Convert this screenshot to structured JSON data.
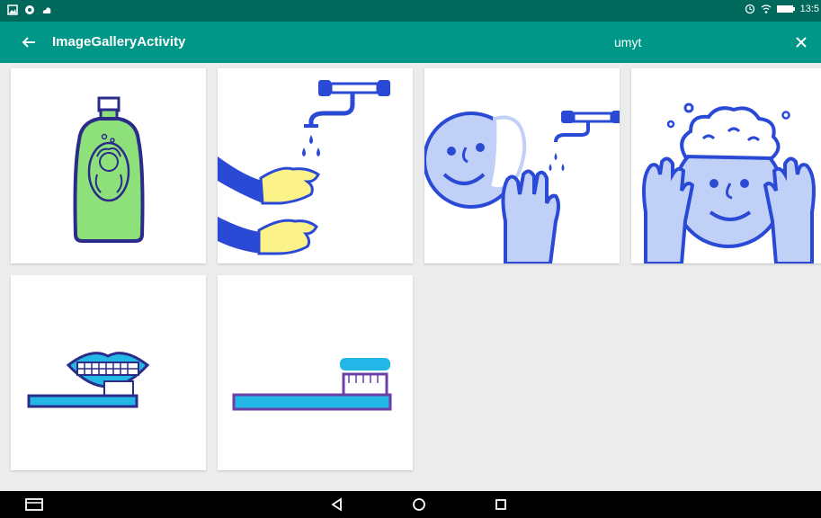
{
  "status_bar": {
    "time": "13:5",
    "left_icons": [
      "gallery-icon",
      "notification-icon",
      "cloud-icon"
    ],
    "right_icons": [
      "alarm-icon",
      "wifi-icon",
      "battery-icon"
    ]
  },
  "toolbar": {
    "title": "ImageGalleryActivity",
    "query": "umyt",
    "back_icon": "arrow-left-icon",
    "close_icon": "close-icon",
    "color": "#009688",
    "status_color": "#00695c"
  },
  "gallery": {
    "items": [
      {
        "subject": "shampoo bottle"
      },
      {
        "subject": "washing hands under tap"
      },
      {
        "subject": "washing face under tap"
      },
      {
        "subject": "washing hair"
      },
      {
        "subject": "brushing teeth"
      },
      {
        "subject": "toothbrush with toothpaste"
      }
    ]
  },
  "nav_bar": {
    "buttons": [
      "keyboard-icon",
      "back-triangle-icon",
      "home-circle-icon",
      "recents-square-icon"
    ]
  }
}
